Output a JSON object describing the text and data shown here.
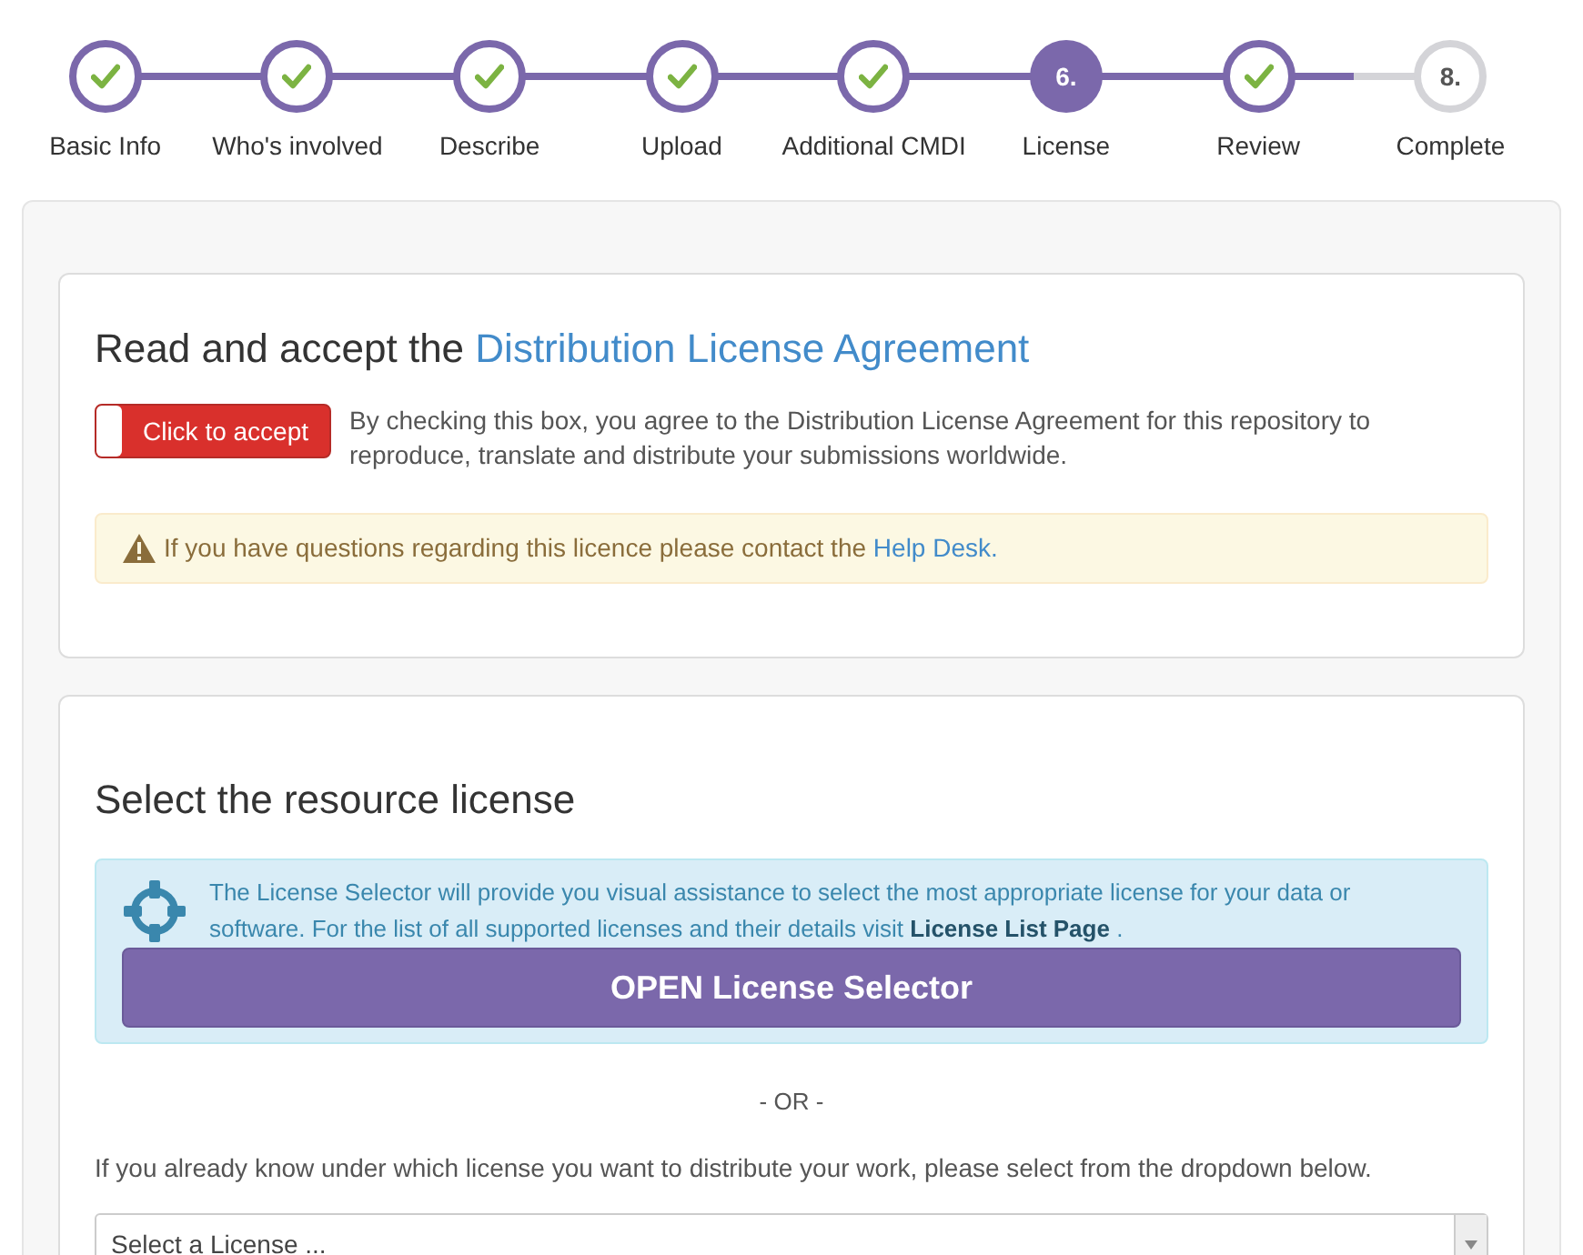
{
  "steps": [
    {
      "label": "Basic Info",
      "completed": true,
      "selected": false
    },
    {
      "label": "Who's involved",
      "completed": true,
      "selected": false
    },
    {
      "label": "Describe",
      "completed": true,
      "selected": false
    },
    {
      "label": "Upload",
      "completed": true,
      "selected": false
    },
    {
      "label": "Additional CMDI",
      "completed": true,
      "selected": false
    },
    {
      "label": "License",
      "completed": false,
      "selected": true,
      "number": "6."
    },
    {
      "label": "Review",
      "completed": true,
      "selected": false
    },
    {
      "label": "Complete",
      "completed": false,
      "selected": false,
      "number": "8."
    }
  ],
  "agreement": {
    "title_plain": "Read and accept the",
    "title_link": "Distribution License Agreement",
    "toggle": {
      "label": "Click to accept",
      "on": false
    },
    "text": "By checking this box, you agree to the Distribution License Agreement for this repository to reproduce, translate and distribute your submissions worldwide.",
    "warning": {
      "text": "If you have questions regarding this licence please contact the",
      "link": "Help Desk."
    }
  },
  "license": {
    "title": "Select the resource license",
    "info": {
      "text": "The License Selector will provide you visual assistance to select the most appropriate license for your data or software. For the list of all supported licenses and their details visit",
      "link": "License List Page",
      "after": "."
    },
    "button": "OPEN License Selector",
    "separator": "- OR -",
    "hint": "If you already know under which license you want to distribute your work, please select from the dropdown below.",
    "select": {
      "placeholder": "Select a License ..."
    }
  }
}
